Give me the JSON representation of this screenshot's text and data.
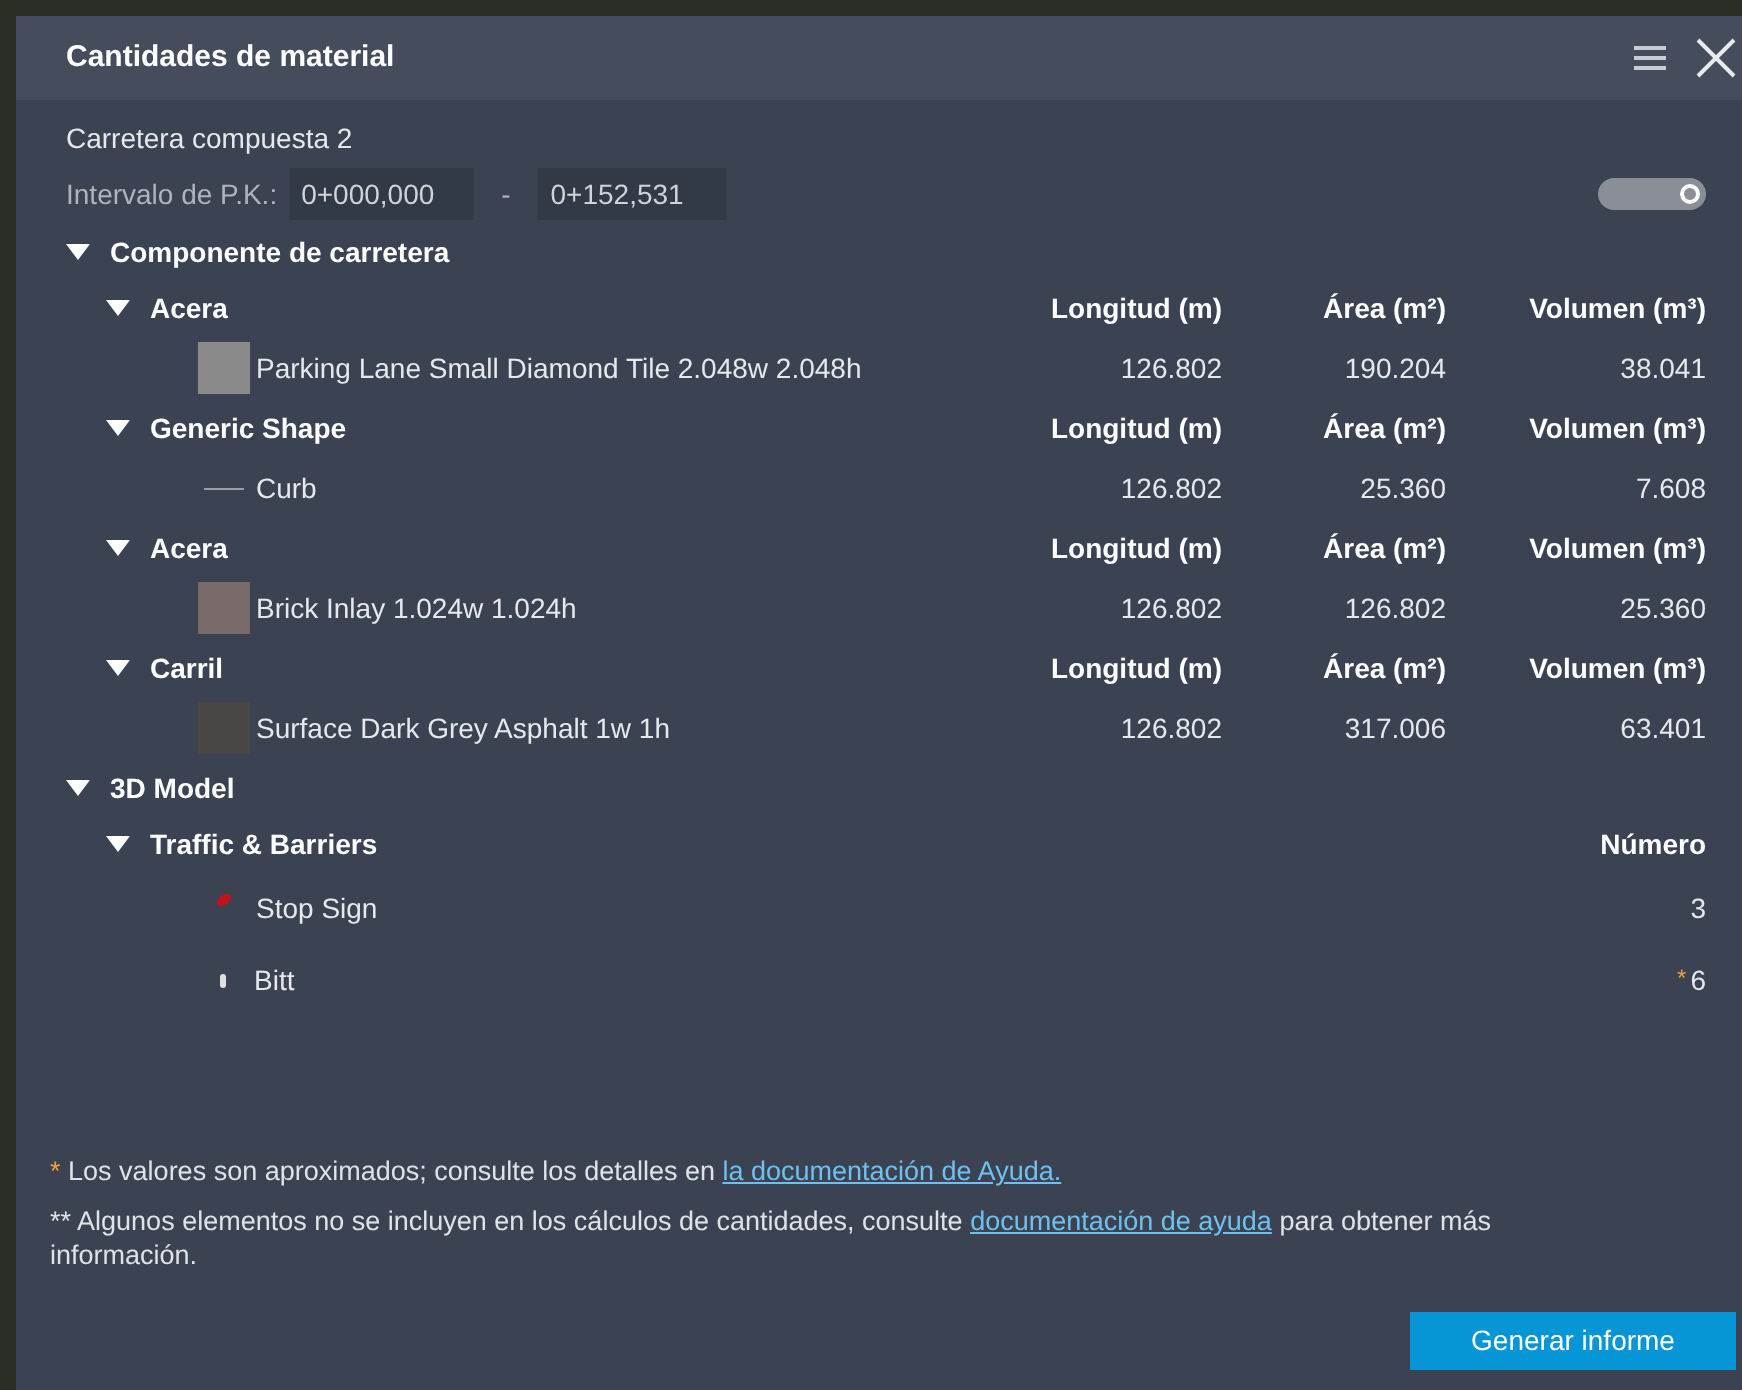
{
  "window": {
    "title": "Cantidades de material"
  },
  "road_name": "Carretera compuesta 2",
  "station_range": {
    "label": "Intervalo de P.K.:",
    "start": "0+000,000",
    "separator": "-",
    "end": "0+152,531"
  },
  "toggle": {
    "on": false
  },
  "sections": [
    {
      "title": "Componente de carretera",
      "expanded": true,
      "groups": [
        {
          "title": "Acera",
          "expanded": true,
          "columns": [
            "Longitud (m)",
            "Área (m²)",
            "Volumen (m³)"
          ],
          "items": [
            {
              "kind": "swatch",
              "color": "#8a8a8a",
              "name": "Parking Lane Small Diamond Tile 2.048w 2.048h",
              "values": [
                "126.802",
                "190.204",
                "38.041"
              ]
            }
          ]
        },
        {
          "title": "Generic Shape",
          "expanded": true,
          "columns": [
            "Longitud (m)",
            "Área (m²)",
            "Volumen (m³)"
          ],
          "items": [
            {
              "kind": "line",
              "name": "Curb",
              "values": [
                "126.802",
                "25.360",
                "7.608"
              ]
            }
          ]
        },
        {
          "title": "Acera",
          "expanded": true,
          "columns": [
            "Longitud (m)",
            "Área (m²)",
            "Volumen (m³)"
          ],
          "items": [
            {
              "kind": "swatch",
              "color": "#7a6a6a",
              "name": "Brick Inlay 1.024w 1.024h",
              "values": [
                "126.802",
                "126.802",
                "25.360"
              ]
            }
          ]
        },
        {
          "title": "Carril",
          "expanded": true,
          "columns": [
            "Longitud (m)",
            "Área (m²)",
            "Volumen (m³)"
          ],
          "items": [
            {
              "kind": "swatch",
              "color": "#4a4644",
              "name": "Surface Dark Grey Asphalt 1w 1h",
              "values": [
                "126.802",
                "317.006",
                "63.401"
              ]
            }
          ]
        }
      ]
    },
    {
      "title": "3D Model",
      "expanded": true,
      "groups": [
        {
          "title": "Traffic & Barriers",
          "expanded": true,
          "columns": [
            "Número"
          ],
          "items": [
            {
              "kind": "sign",
              "name": "Stop Sign",
              "values": [
                "3"
              ],
              "approximate": false
            },
            {
              "kind": "post",
              "name": "Bitt",
              "values": [
                "6"
              ],
              "approximate": true
            }
          ]
        }
      ]
    }
  ],
  "notes": [
    {
      "marker": "*",
      "text": "Los valores son aproximados; consulte los detalles en ",
      "link": "la documentación de Ayuda."
    },
    {
      "marker": "**",
      "text": "Algunos elementos no se incluyen en los cálculos de cantidades, consulte ",
      "link": "documentación de ayuda",
      "after": " para obtener más información."
    }
  ],
  "approx_marker": "*",
  "buttons": [
    "Generar informe"
  ]
}
